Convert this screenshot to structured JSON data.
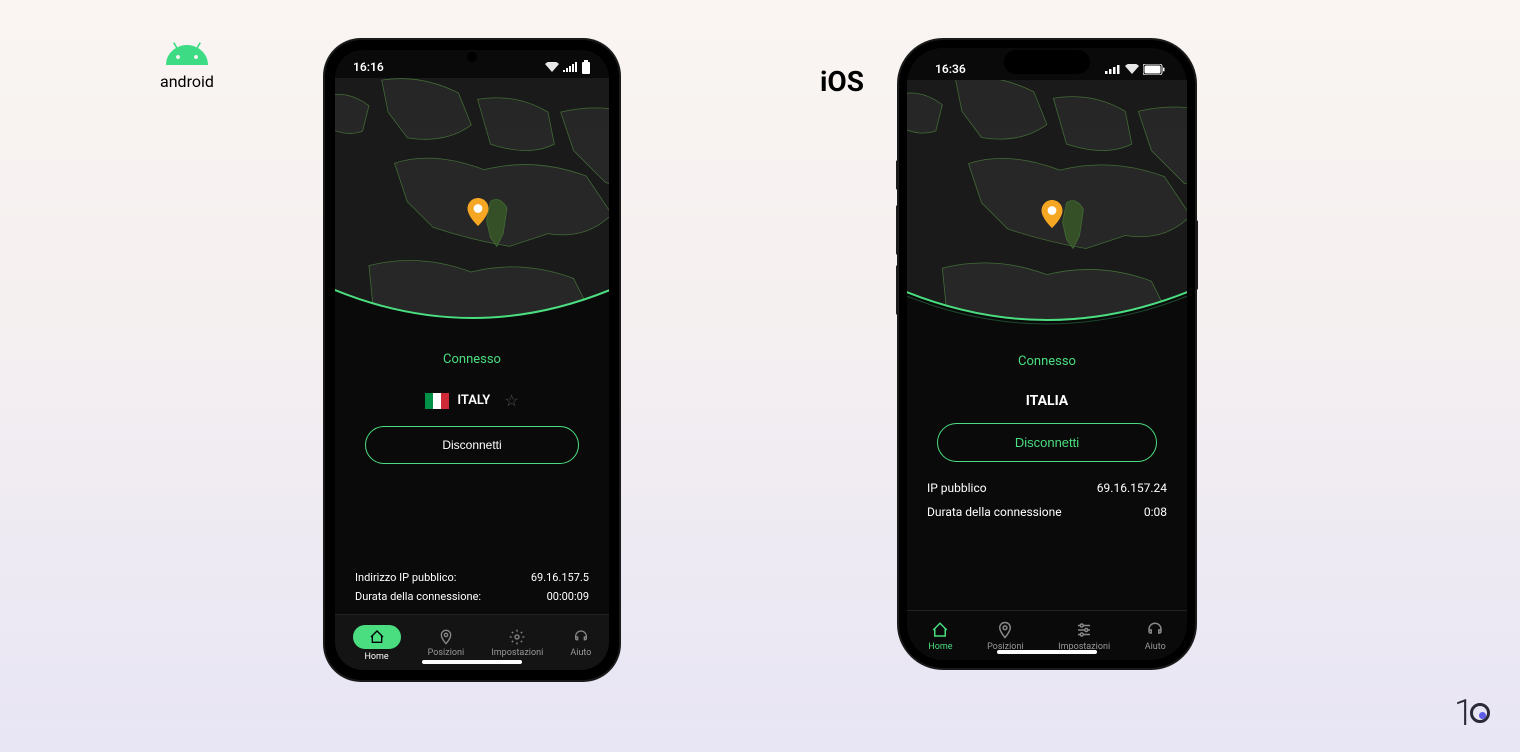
{
  "platforms": {
    "android": {
      "label": "android"
    },
    "ios": {
      "label": "iOS"
    }
  },
  "android": {
    "status_bar": {
      "time": "16:16"
    },
    "connection": {
      "status": "Connesso",
      "country": "ITALY",
      "flag_colors": [
        "#009246",
        "#ffffff",
        "#ce2b37"
      ],
      "disconnect_label": "Disconnetti"
    },
    "info": {
      "ip_label": "Indirizzo IP pubblico:",
      "ip_value": "69.16.157.5",
      "duration_label": "Durata della connessione:",
      "duration_value": "00:00:09"
    },
    "nav": {
      "home": "Home",
      "locations": "Posizioni",
      "settings": "Impostazioni",
      "help": "Aiuto"
    }
  },
  "ios": {
    "status_bar": {
      "time": "16:36"
    },
    "connection": {
      "status": "Connesso",
      "country": "ITALIA",
      "disconnect_label": "Disconnetti"
    },
    "info": {
      "ip_label": "IP pubblico",
      "ip_value": "69.16.157.24",
      "duration_label": "Durata della connessione",
      "duration_value": "0:08"
    },
    "nav": {
      "home": "Home",
      "locations": "Posizioni",
      "settings": "Impostazioni",
      "help": "Aiuto"
    }
  },
  "watermark": "1"
}
